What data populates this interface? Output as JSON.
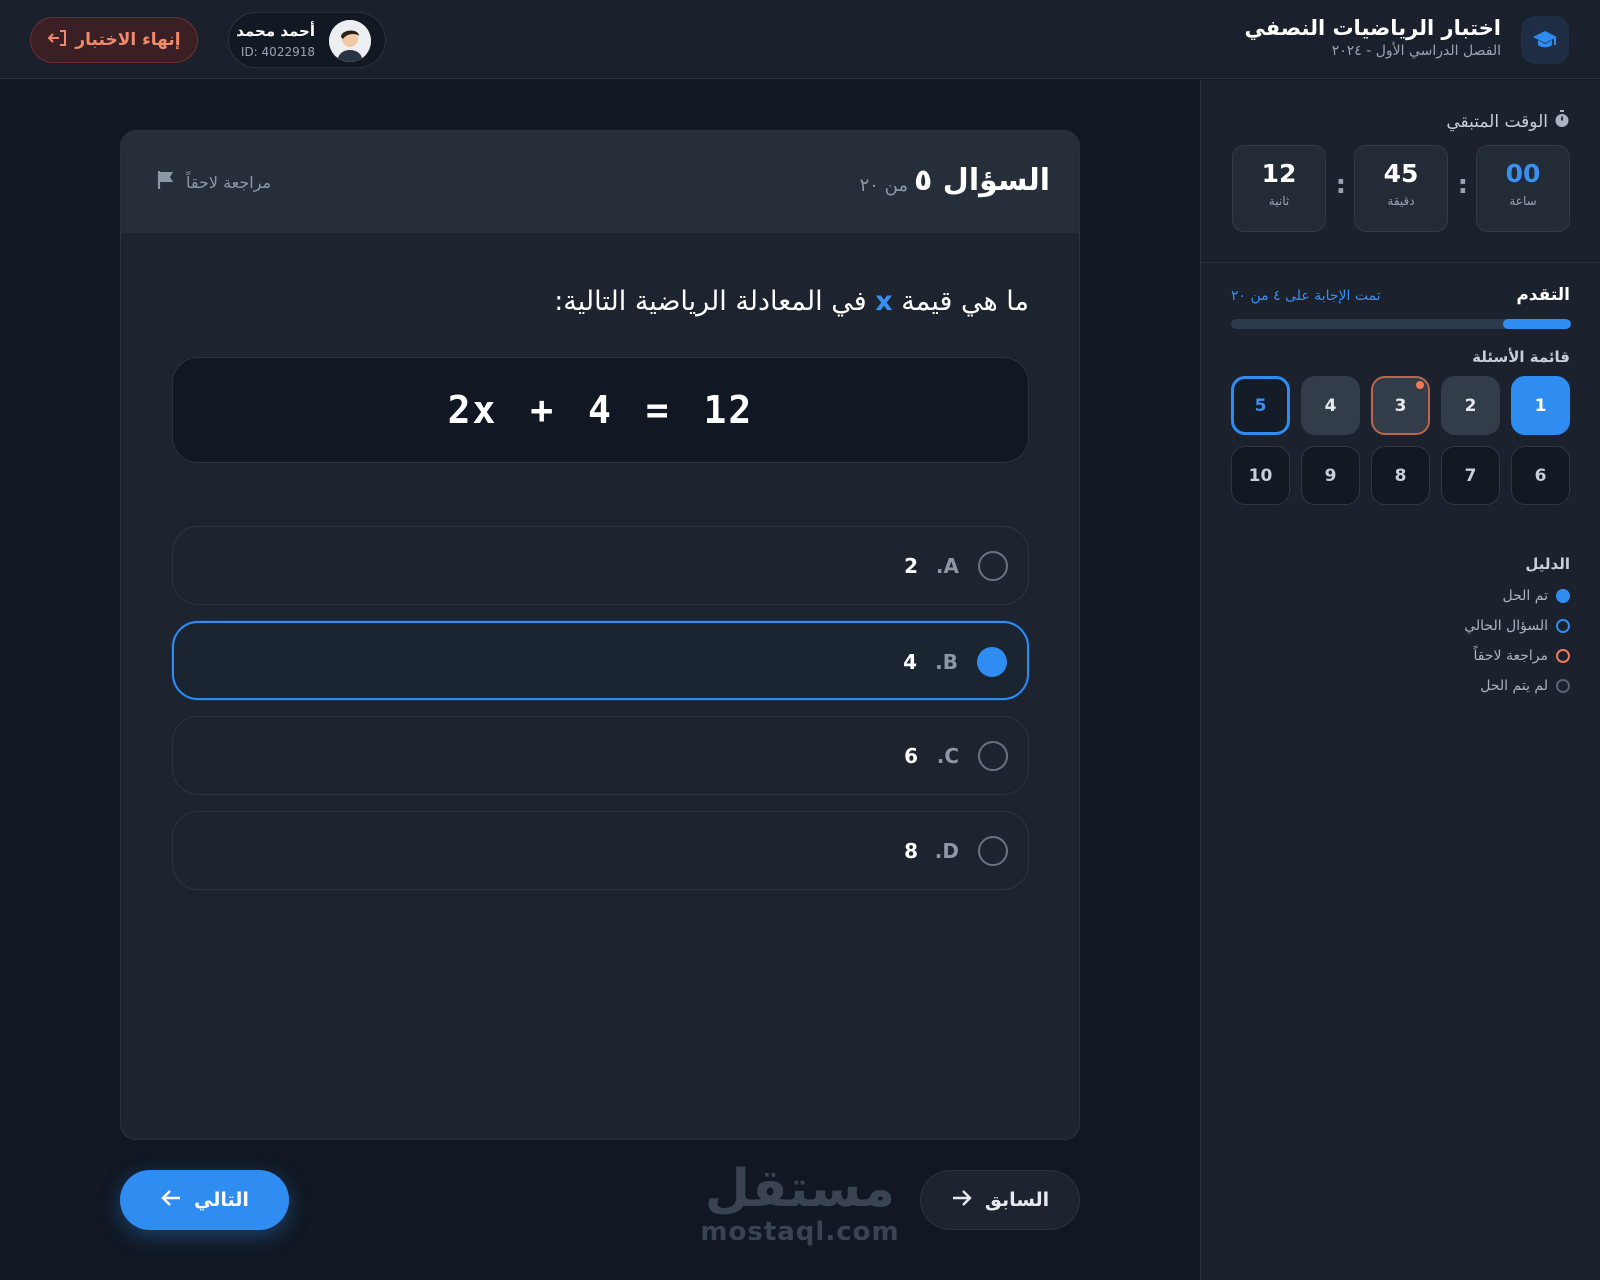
{
  "header": {
    "title": "اختبار الرياضيات النصفي",
    "subtitle": "الفصل الدراسي الأول - ٢٠٢٤",
    "user_name": "أحمد محمد",
    "user_id": "ID: 4022918",
    "end_exam_label": "إنهاء الاختبار"
  },
  "sidebar": {
    "timer_label": "الوقت المتبقي",
    "timer": {
      "hours": "00",
      "hours_label": "ساعة",
      "minutes": "45",
      "minutes_label": "دقيقة",
      "seconds": "12",
      "seconds_label": "ثانية"
    },
    "progress_title": "التقدم",
    "progress_text": "تمت الإجابة على ٤ من ٢٠",
    "progress_fraction": 0.2,
    "question_list_title": "قائمة الأسئلة",
    "questions": [
      {
        "number": "1",
        "state": "answered"
      },
      {
        "number": "2",
        "state": "solved"
      },
      {
        "number": "3",
        "state": "review"
      },
      {
        "number": "4",
        "state": "solved"
      },
      {
        "number": "5",
        "state": "current"
      },
      {
        "number": "6",
        "state": "unsolved"
      },
      {
        "number": "7",
        "state": "unsolved"
      },
      {
        "number": "8",
        "state": "unsolved"
      },
      {
        "number": "9",
        "state": "unsolved"
      },
      {
        "number": "10",
        "state": "unsolved"
      }
    ],
    "legend_title": "الدليل",
    "legend": [
      {
        "label": "تم الحل",
        "kind": "solved"
      },
      {
        "label": "السؤال الحالي",
        "kind": "current"
      },
      {
        "label": "مراجعة لاحقاً",
        "kind": "review"
      },
      {
        "label": "لم يتم الحل",
        "kind": "unsolved"
      }
    ]
  },
  "question": {
    "title": "السؤال ٥",
    "of_total": "من ٢٠",
    "review_later_label": "مراجعة لاحقاً",
    "text_before": "ما هي قيمة",
    "variable": "x",
    "text_after": "في المعادلة الرياضية التالية:",
    "equation": "2x + 4 = 12",
    "options": [
      {
        "letter": ".A",
        "value": "2",
        "selected": false
      },
      {
        "letter": ".B",
        "value": "4",
        "selected": true
      },
      {
        "letter": ".C",
        "value": "6",
        "selected": false
      },
      {
        "letter": ".D",
        "value": "8",
        "selected": false
      }
    ]
  },
  "nav": {
    "next_label": "التالي",
    "prev_label": "السابق"
  },
  "watermark": {
    "arabic": "مستقل",
    "latin": "mostaql.com"
  },
  "colors": {
    "accent": "#2f8cf0",
    "review": "#f07a5a",
    "danger": "#f08a6a",
    "background": "#111823"
  }
}
